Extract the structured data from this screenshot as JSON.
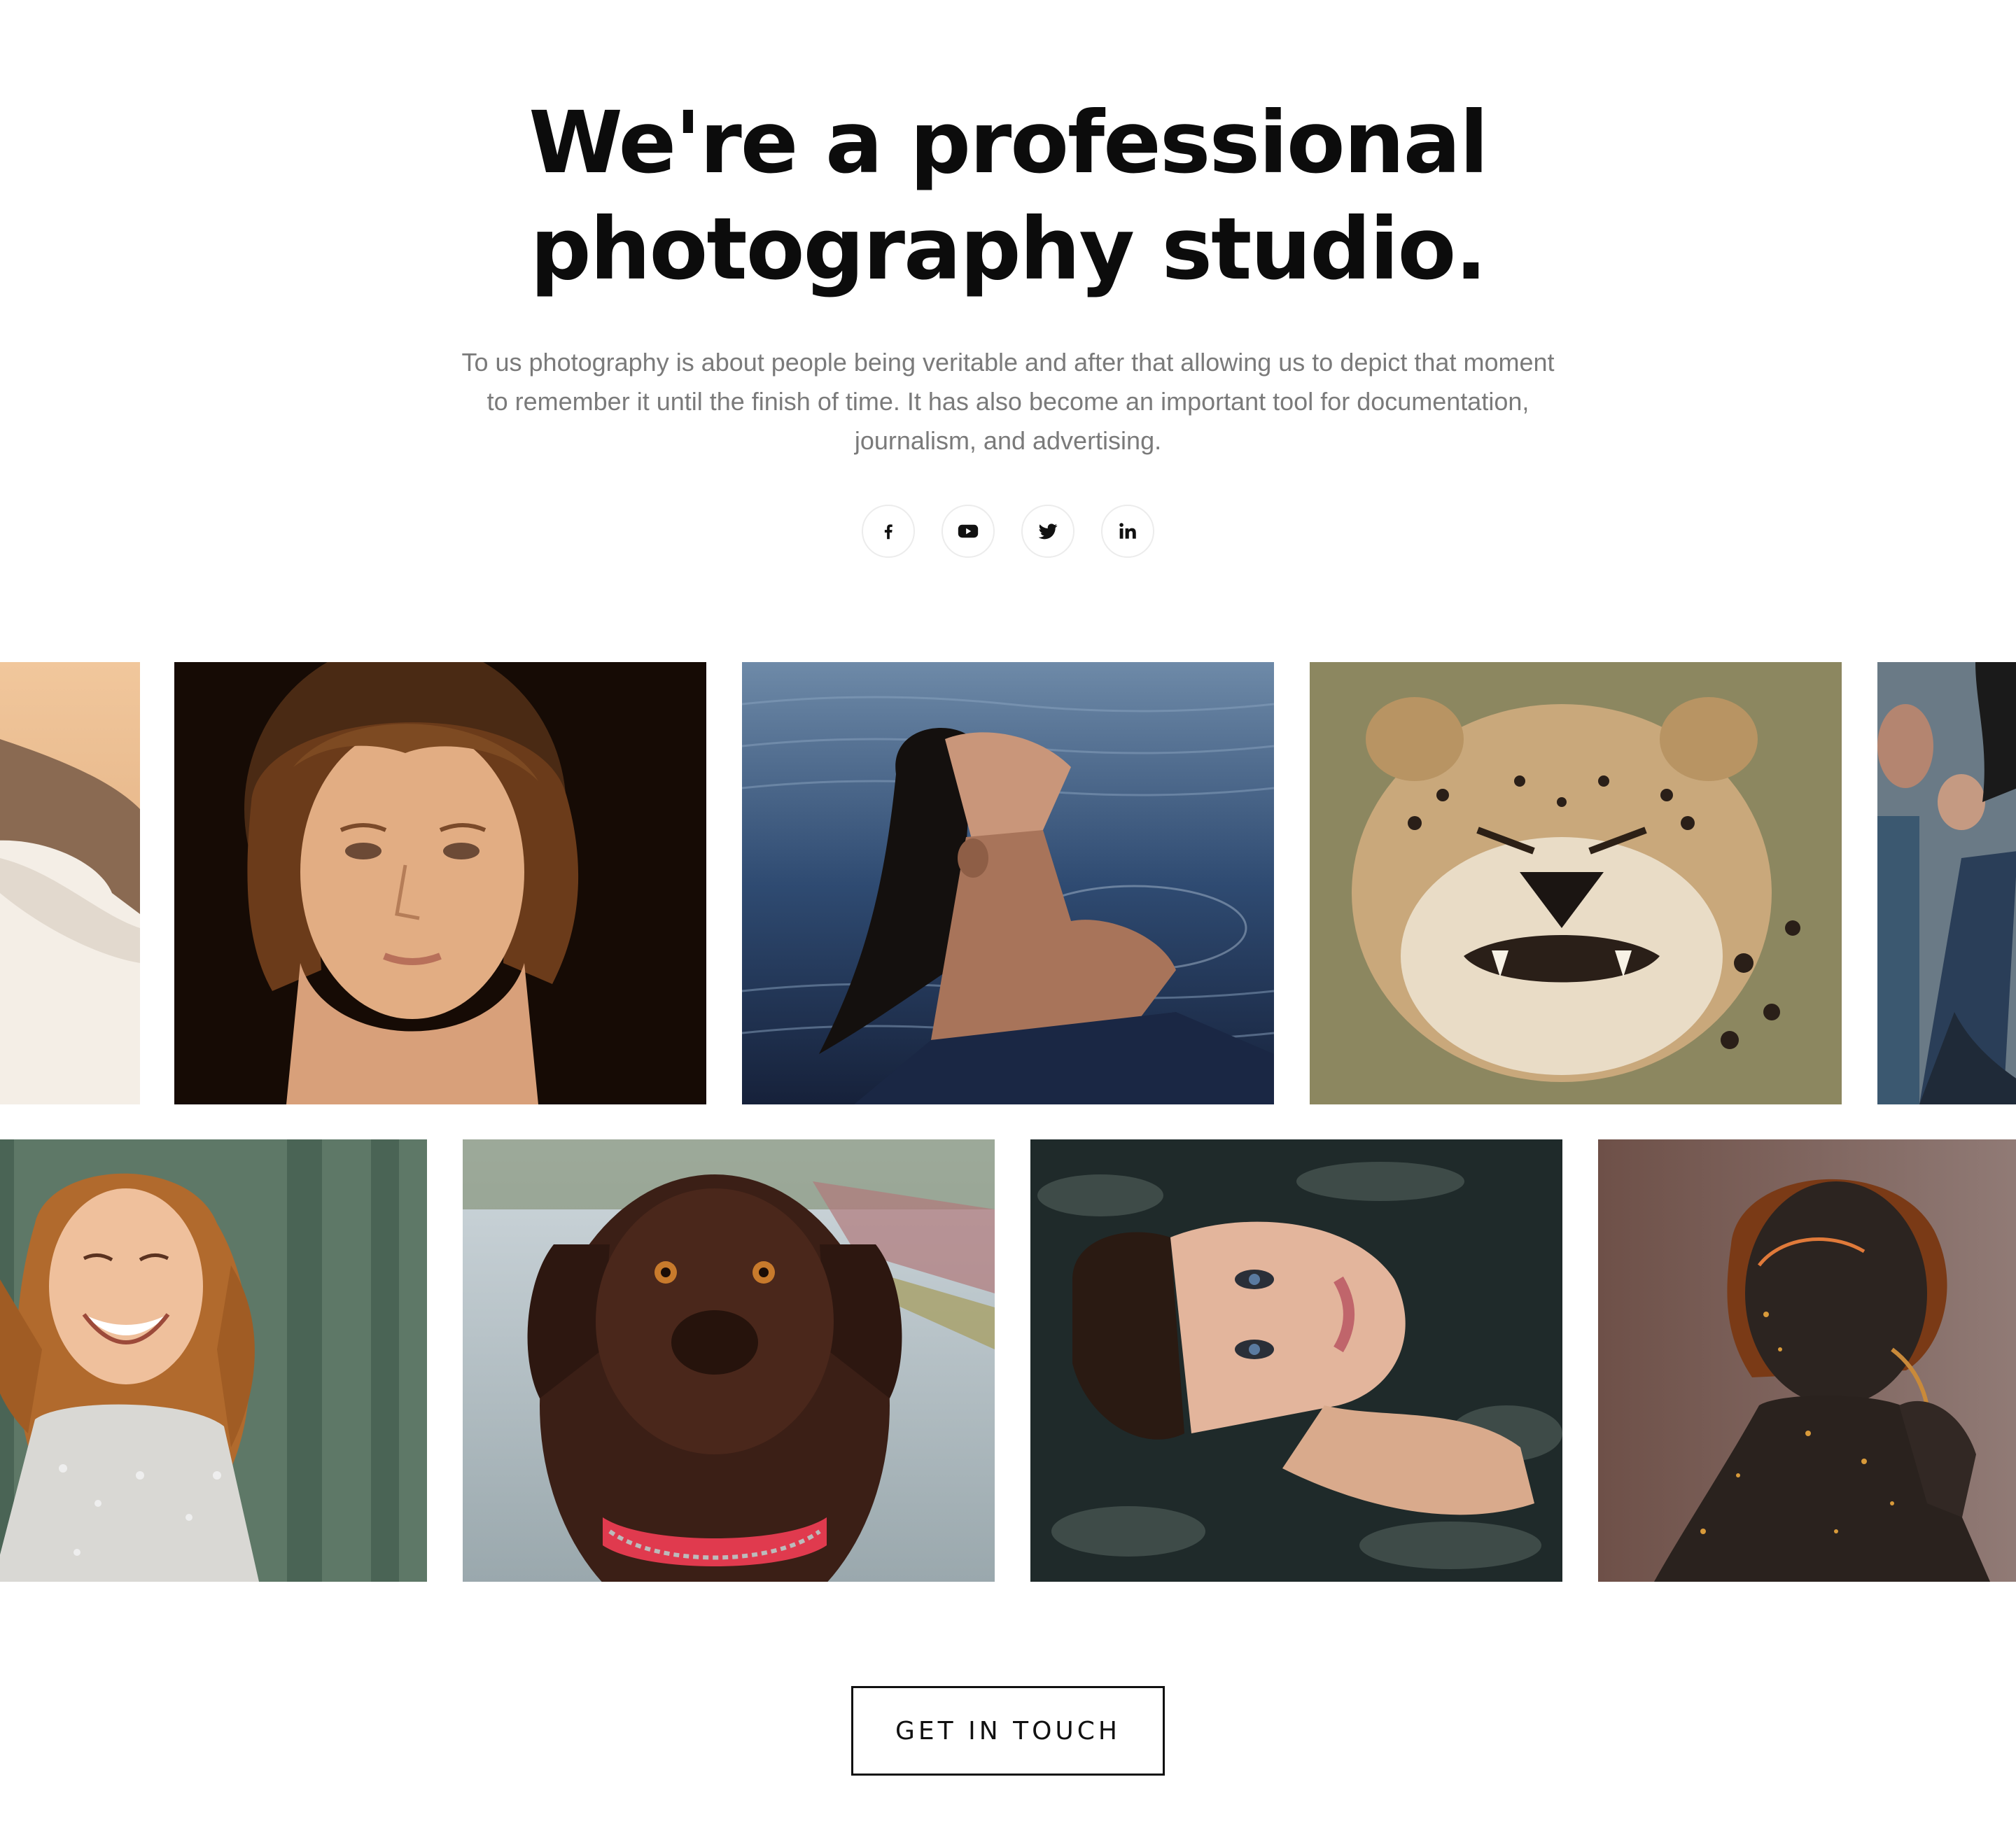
{
  "hero": {
    "title_line_1": "We're a professional",
    "title_line_2": "photography studio.",
    "intro_line_1": "To us photography is about people being veritable and after that allowing us to depict that moment",
    "intro_line_2": "to remember it until the finish of time. It has also become an important tool for documentation,",
    "intro_line_3": "journalism, and advertising."
  },
  "social": [
    {
      "icon": "facebook-icon"
    },
    {
      "icon": "youtube-icon"
    },
    {
      "icon": "twitter-icon"
    },
    {
      "icon": "linkedin-icon"
    }
  ],
  "gallery": {
    "row_1": [
      "woman-on-hillside-photo",
      "young-woman-portrait-photo",
      "woman-in-water-photo",
      "cheetah-snarling-photo",
      "man-in-crowd-photo"
    ],
    "row_2": [
      "laughing-woman-photo",
      "brown-labrador-photo",
      "woman-floating-photo",
      "gold-painted-woman-photo"
    ]
  },
  "cta": {
    "label": "GET IN TOUCH"
  },
  "colors": {
    "text": "#0c0c0c",
    "muted": "#7a7a7a",
    "border": "#111111"
  }
}
